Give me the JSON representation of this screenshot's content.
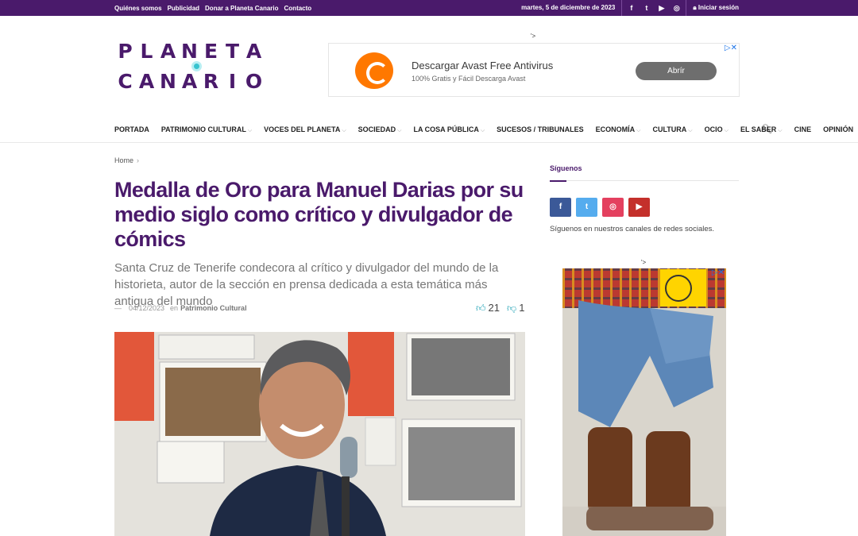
{
  "topbar": {
    "links": [
      "Quiénes somos",
      "Publicidad",
      "Donar a Planeta Canario",
      "Contacto"
    ],
    "date": "martes, 5 de diciembre de 2023",
    "social_icons": [
      "facebook-icon",
      "twitter-icon",
      "youtube-icon",
      "instagram-icon"
    ],
    "social_glyphs": [
      "f",
      "t",
      "▶",
      "◎"
    ],
    "login_label": "Iniciar sesión",
    "bg_color": "#4a1a6b"
  },
  "logo": {
    "row1": [
      "P",
      "L",
      "A",
      "N",
      "E",
      "T",
      "A"
    ],
    "row2": [
      "C",
      "A",
      "N",
      "A",
      "R",
      "I",
      "O"
    ]
  },
  "ad_top": {
    "tag": "'>",
    "headline": "Descargar Avast Free Antivirus",
    "subline": "100% Gratis y Fácil Descarga Avast",
    "button": "Abrír",
    "ad_choices": "▷✕"
  },
  "nav": {
    "items": [
      {
        "label": "PORTADA",
        "dropdown": false
      },
      {
        "label": "PATRIMONIO CULTURAL",
        "dropdown": true
      },
      {
        "label": "VOCES DEL PLANETA",
        "dropdown": true
      },
      {
        "label": "SOCIEDAD",
        "dropdown": true
      },
      {
        "label": "LA COSA PÚBLICA",
        "dropdown": true
      },
      {
        "label": "SUCESOS / TRIBUNALES",
        "dropdown": false
      },
      {
        "label": "ECONOMÍA",
        "dropdown": true
      },
      {
        "label": "CULTURA",
        "dropdown": true
      },
      {
        "label": "OCIO",
        "dropdown": true
      },
      {
        "label": "EL SABER",
        "dropdown": true
      },
      {
        "label": "CINE",
        "dropdown": false
      },
      {
        "label": "OPINIÓN",
        "dropdown": false
      }
    ],
    "chevron": "⌵"
  },
  "article": {
    "breadcrumb": "Home",
    "breadcrumb_sep": "›",
    "title": "Medalla de Oro para Manuel Darias por su medio siglo como crítico y divulgador de cómics",
    "subtitle": "Santa Cruz de Tenerife condecora al crítico y divulgador del mundo de la historieta, autor de la sección en prensa dedicada a esta temática más antigua del mundo",
    "meta_dash": "—",
    "date": "04/12/2023",
    "in_label": "en",
    "category": "Patrimonio Cultural",
    "likes": "21",
    "dislikes": "1",
    "title_color": "#4a1a6b"
  },
  "sidebar": {
    "heading": "Síguenos",
    "buttons": [
      {
        "icon": "facebook-icon",
        "glyph": "f",
        "color": "#3b5998"
      },
      {
        "icon": "twitter-icon",
        "glyph": "t",
        "color": "#55acee"
      },
      {
        "icon": "instagram-icon",
        "glyph": "◎",
        "color": "#e4405f"
      },
      {
        "icon": "youtube-icon",
        "glyph": "▶",
        "color": "#c4302b"
      }
    ],
    "text": "Síguenos en nuestros canales de redes sociales.",
    "ad_tag": "'>",
    "ad_choices": "▷✕"
  }
}
